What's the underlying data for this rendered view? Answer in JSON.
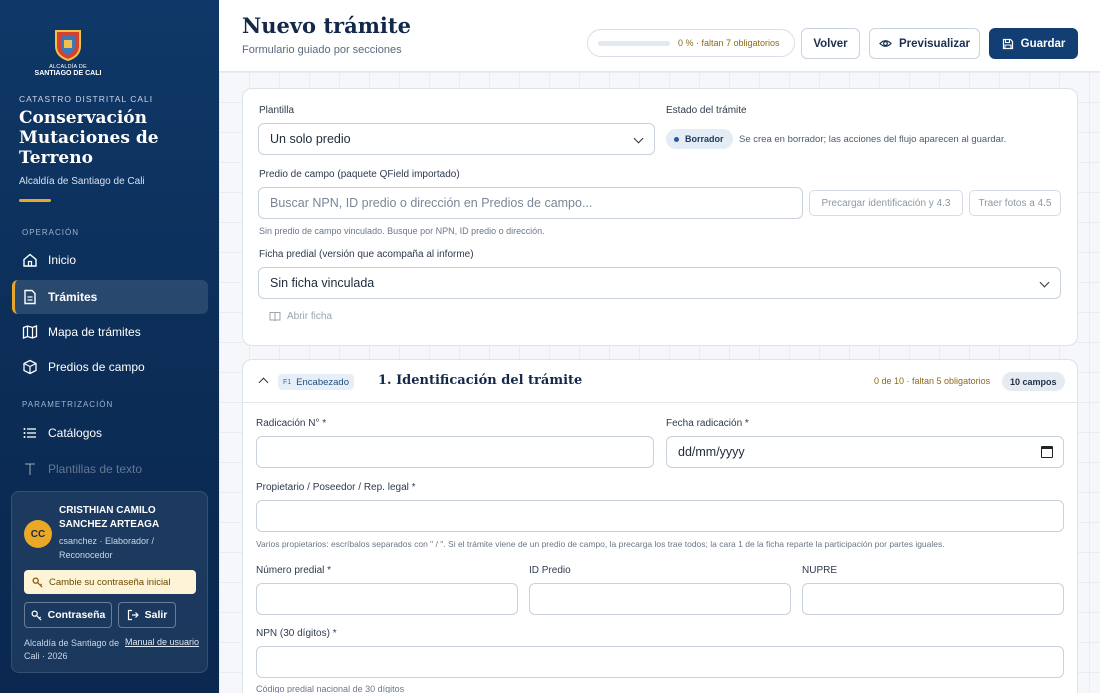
{
  "sidebar": {
    "logo": {
      "line1": "ALCALDÍA DE",
      "line2": "SANTIAGO DE CALI"
    },
    "kicker": "CATASTRO DISTRITAL CALI",
    "title": "Conservación Mutaciones de Terreno",
    "subtitle": "Alcaldía de Santiago de Cali",
    "section_operacion": "OPERACIÓN",
    "section_param": "PARAMETRIZACIÓN",
    "nav": {
      "inicio": "Inicio",
      "tramites": "Trámites",
      "mapa": "Mapa de trámites",
      "predios": "Predios de campo",
      "catalogos": "Catálogos",
      "plantillas": "Plantillas de texto"
    },
    "user": {
      "initials": "CC",
      "name": "CRISTHIAN CAMILO SANCHEZ ARTEAGA",
      "role": "csanchez · Elaborador / Reconocedor",
      "password_warning": "Cambie su contraseña inicial",
      "password_button": "Contraseña",
      "logout_button": "Salir",
      "footer": "Alcaldía de Santiago de Cali · 2026",
      "manual": "Manual de usuario"
    }
  },
  "header": {
    "title": "Nuevo trámite",
    "subtitle": "Formulario guiado por secciones",
    "progress_text": "0 % · faltan 7 obligatorios",
    "progress_fraction": 0,
    "back": "Volver",
    "preview": "Previsualizar",
    "save": "Guardar"
  },
  "template_card": {
    "plantilla_label": "Plantilla",
    "plantilla_value": "Un solo predio",
    "estado_label": "Estado del trámite",
    "estado_badge": "Borrador",
    "estado_note": "Se crea en borrador; las acciones del flujo aparecen al guardar.",
    "predio_label": "Predio de campo (paquete QField importado)",
    "predio_placeholder": "Buscar NPN, ID predio o dirección en Predios de campo...",
    "precargar_button": "Precargar identificación y 4.3",
    "fotos_button": "Traer fotos a 4.5",
    "predio_hint": "Sin predio de campo vinculado. Busque por NPN, ID predio o dirección.",
    "ficha_label": "Ficha predial (versión que acompaña al informe)",
    "ficha_value": "Sin ficha vinculada",
    "abrir_ficha": "Abrir ficha"
  },
  "section1": {
    "badge_key": "F1",
    "badge_label": "Encabezado",
    "title": "1. Identificación del trámite",
    "count": "0 de 10 · faltan 5 obligatorios",
    "fields_pill": "10 campos",
    "radicacion_label": "Radicación N° *",
    "radicacion_value": "",
    "fecha_label": "Fecha radicación *",
    "fecha_value": "dd/mm/yyyy",
    "propietario_label": "Propietario / Poseedor / Rep. legal *",
    "propietario_value": "",
    "propietario_hint": "Varios propietarios: escríbalos separados con \" / \". Si el trámite viene de un predio de campo, la precarga los trae todos; la cara 1 de la ficha reparte la participación por partes iguales.",
    "numero_predial_label": "Número predial *",
    "id_predio_label": "ID Predio",
    "nupre_label": "NUPRE",
    "npn_label": "NPN (30 dígitos) *",
    "npn_hint": "Código predial nacional de 30 dígitos"
  }
}
